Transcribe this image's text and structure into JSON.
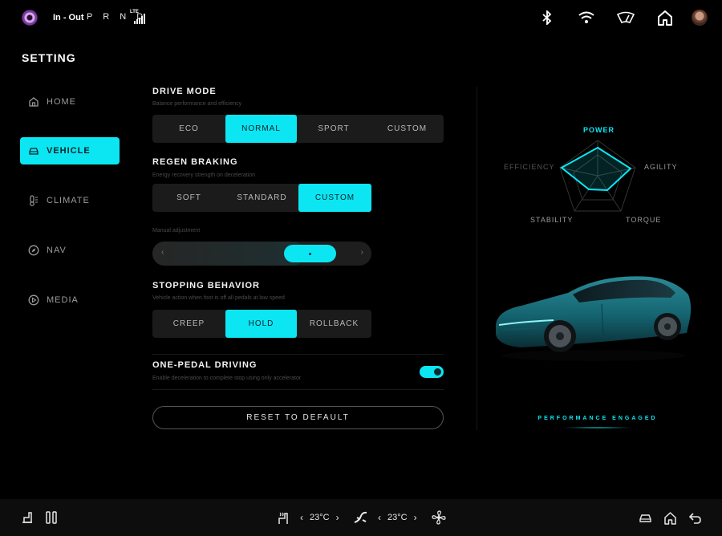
{
  "status": {
    "route": "In - Out",
    "gears": "P R N D",
    "network": "LTE"
  },
  "page_title": "SETTING",
  "nav": [
    {
      "label": "HOME",
      "icon": "home-icon"
    },
    {
      "label": "VEHICLE",
      "icon": "car-icon",
      "active": true
    },
    {
      "label": "CLIMATE",
      "icon": "thermometer-icon"
    },
    {
      "label": "NAV",
      "icon": "compass-icon"
    },
    {
      "label": "MEDIA",
      "icon": "play-icon"
    }
  ],
  "drive_mode": {
    "title": "DRIVE MODE",
    "subtitle": "Balance performance and efficiency",
    "options": [
      "ECO",
      "NORMAL",
      "SPORT",
      "CUSTOM"
    ],
    "selected": "NORMAL"
  },
  "regen": {
    "title": "REGEN BRAKING",
    "subtitle": "Energy recovery strength on deceleration",
    "options": [
      "SOFT",
      "STANDARD",
      "CUSTOM"
    ],
    "selected": "CUSTOM",
    "manual_label": "Manual adjustment",
    "left_arrow": "‹",
    "right_arrow": "›"
  },
  "stopping": {
    "title": "STOPPING BEHAVIOR",
    "subtitle": "Vehicle action when foot is off all pedals at low speed",
    "options": [
      "CREEP",
      "HOLD",
      "ROLLBACK"
    ],
    "selected": "HOLD"
  },
  "one_pedal": {
    "title": "ONE-PEDAL DRIVING",
    "subtitle": "Enable deceleration to complete stop using only accelerator",
    "enabled": true
  },
  "reset_label": "RESET TO DEFAULT",
  "radar": {
    "labels": {
      "power": "POWER",
      "agility": "AGILITY",
      "torque": "TORQUE",
      "stability": "STABILITY",
      "efficiency": "EFFICIENCY"
    }
  },
  "performance_text": "PERFORMANCE ENGAGED",
  "bottom": {
    "left_temp": "23°C",
    "right_temp": "23°C",
    "chev_left": "‹",
    "chev_right": "›"
  },
  "colors": {
    "accent": "#0ce6f2",
    "background": "#000000"
  }
}
